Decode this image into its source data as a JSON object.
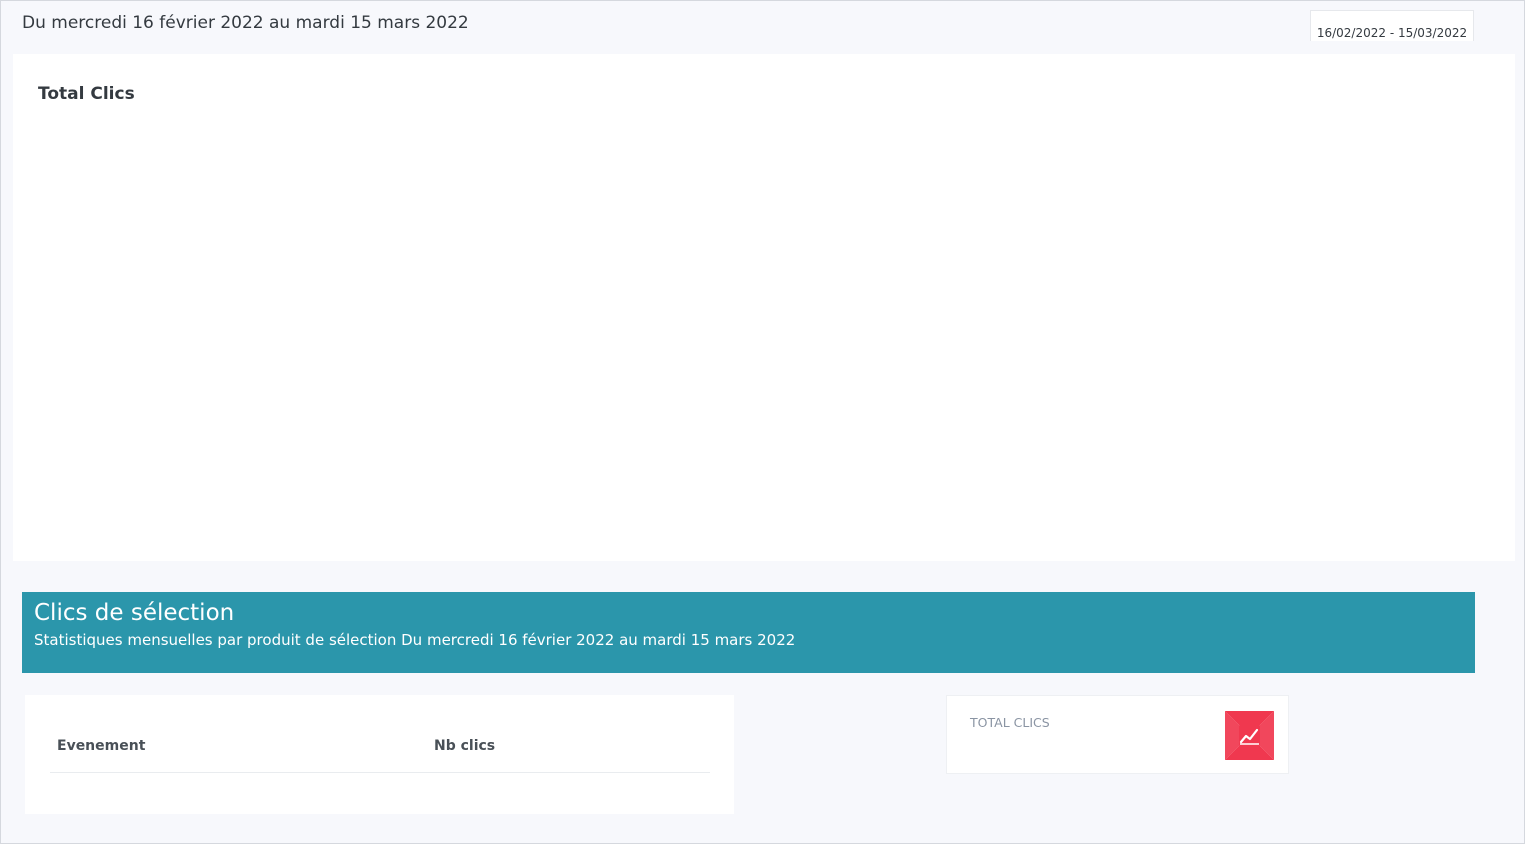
{
  "header": {
    "period_text": "Du mercredi 16 février 2022 au mardi 15 mars 2022",
    "date_range": "16/02/2022 - 15/03/2022"
  },
  "chart_card": {
    "title": "Total Clics"
  },
  "section": {
    "title": "Clics de sélection",
    "subtitle": "Statistiques mensuelles par produit de sélection Du mercredi 16 février 2022 au mardi 15 mars 2022"
  },
  "table": {
    "columns": [
      "Evenement",
      "Nb clics"
    ],
    "rows": []
  },
  "stat_card": {
    "label": "TOTAL CLICS",
    "value": "",
    "icon": "chart-line-icon"
  },
  "colors": {
    "page_background": "#f7f8fc",
    "banner": "#2b96ab",
    "icon_accent": "#f0384f"
  }
}
